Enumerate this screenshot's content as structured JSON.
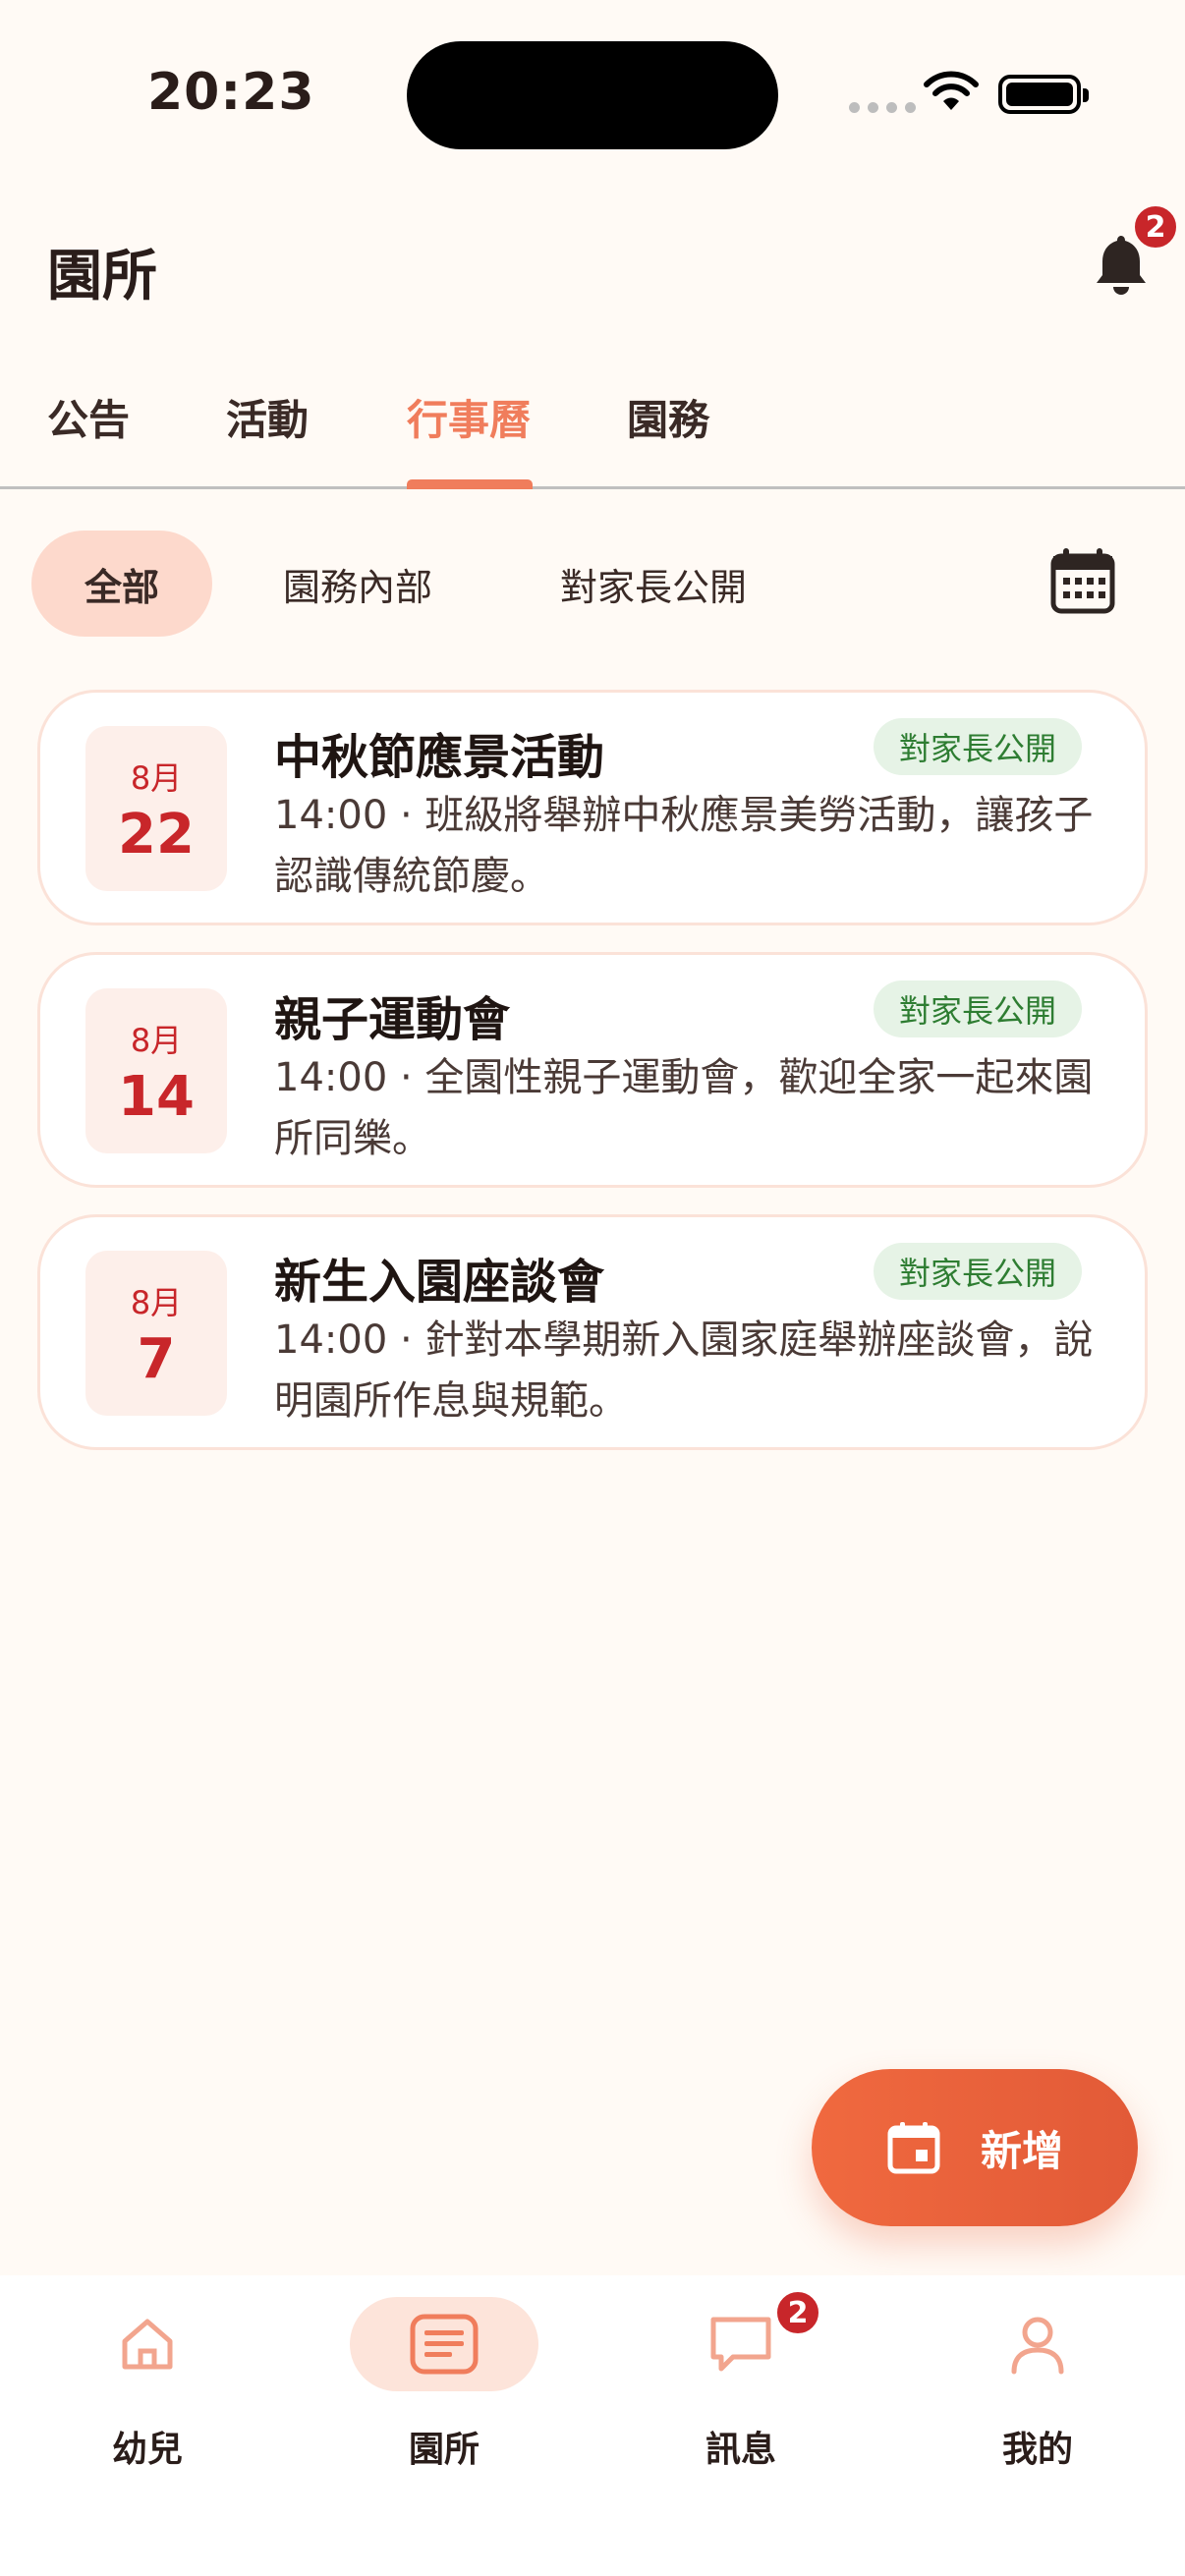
{
  "status_bar": {
    "time": "20:23"
  },
  "header": {
    "title": "園所",
    "notification_count": "2"
  },
  "tabs": [
    {
      "label": "公告",
      "active": false
    },
    {
      "label": "活動",
      "active": false
    },
    {
      "label": "行事曆",
      "active": true
    },
    {
      "label": "園務",
      "active": false
    }
  ],
  "filters": [
    {
      "label": "全部",
      "active": true
    },
    {
      "label": "園務內部",
      "active": false
    },
    {
      "label": "對家長公開",
      "active": false
    }
  ],
  "events": [
    {
      "month": "8月",
      "day": "22",
      "title": "中秋節應景活動",
      "badge": "對家長公開",
      "description": "14:00 · 班級將舉辦中秋應景美勞活動，讓孩子認識傳統節慶。"
    },
    {
      "month": "8月",
      "day": "14",
      "title": "親子運動會",
      "badge": "對家長公開",
      "description": "14:00 · 全園性親子運動會，歡迎全家一起來園所同樂。"
    },
    {
      "month": "8月",
      "day": "7",
      "title": "新生入園座談會",
      "badge": "對家長公開",
      "description": "14:00 · 針對本學期新入園家庭舉辦座談會，說明園所作息與規範。"
    }
  ],
  "fab": {
    "label": "新增",
    "icon": "calendar-icon"
  },
  "bottom_nav": [
    {
      "label": "幼兒",
      "icon": "home-icon",
      "active": false
    },
    {
      "label": "園所",
      "icon": "document-icon",
      "active": true
    },
    {
      "label": "訊息",
      "icon": "chat-icon",
      "active": false,
      "badge": "2"
    },
    {
      "label": "我的",
      "icon": "person-icon",
      "active": false
    }
  ],
  "colors": {
    "accent": "#F07D5C",
    "fab": "#EB6440",
    "date_red": "#C8262A",
    "badge_green_bg": "#E6F3E6",
    "badge_green_text": "#2E7D32",
    "background": "#FFFAF5"
  }
}
